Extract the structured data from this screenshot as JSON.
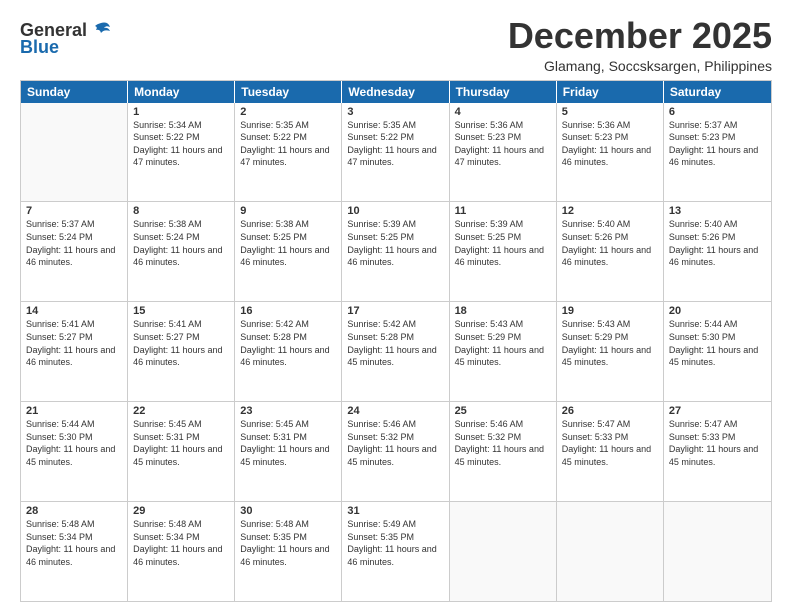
{
  "logo": {
    "line1": "General",
    "line2": "Blue"
  },
  "title": "December 2025",
  "subtitle": "Glamang, Soccsksargen, Philippines",
  "days_of_week": [
    "Sunday",
    "Monday",
    "Tuesday",
    "Wednesday",
    "Thursday",
    "Friday",
    "Saturday"
  ],
  "weeks": [
    [
      {
        "day": "",
        "sunrise": "",
        "sunset": "",
        "daylight": ""
      },
      {
        "day": "1",
        "sunrise": "Sunrise: 5:34 AM",
        "sunset": "Sunset: 5:22 PM",
        "daylight": "Daylight: 11 hours and 47 minutes."
      },
      {
        "day": "2",
        "sunrise": "Sunrise: 5:35 AM",
        "sunset": "Sunset: 5:22 PM",
        "daylight": "Daylight: 11 hours and 47 minutes."
      },
      {
        "day": "3",
        "sunrise": "Sunrise: 5:35 AM",
        "sunset": "Sunset: 5:22 PM",
        "daylight": "Daylight: 11 hours and 47 minutes."
      },
      {
        "day": "4",
        "sunrise": "Sunrise: 5:36 AM",
        "sunset": "Sunset: 5:23 PM",
        "daylight": "Daylight: 11 hours and 47 minutes."
      },
      {
        "day": "5",
        "sunrise": "Sunrise: 5:36 AM",
        "sunset": "Sunset: 5:23 PM",
        "daylight": "Daylight: 11 hours and 46 minutes."
      },
      {
        "day": "6",
        "sunrise": "Sunrise: 5:37 AM",
        "sunset": "Sunset: 5:23 PM",
        "daylight": "Daylight: 11 hours and 46 minutes."
      }
    ],
    [
      {
        "day": "7",
        "sunrise": "Sunrise: 5:37 AM",
        "sunset": "Sunset: 5:24 PM",
        "daylight": "Daylight: 11 hours and 46 minutes."
      },
      {
        "day": "8",
        "sunrise": "Sunrise: 5:38 AM",
        "sunset": "Sunset: 5:24 PM",
        "daylight": "Daylight: 11 hours and 46 minutes."
      },
      {
        "day": "9",
        "sunrise": "Sunrise: 5:38 AM",
        "sunset": "Sunset: 5:25 PM",
        "daylight": "Daylight: 11 hours and 46 minutes."
      },
      {
        "day": "10",
        "sunrise": "Sunrise: 5:39 AM",
        "sunset": "Sunset: 5:25 PM",
        "daylight": "Daylight: 11 hours and 46 minutes."
      },
      {
        "day": "11",
        "sunrise": "Sunrise: 5:39 AM",
        "sunset": "Sunset: 5:25 PM",
        "daylight": "Daylight: 11 hours and 46 minutes."
      },
      {
        "day": "12",
        "sunrise": "Sunrise: 5:40 AM",
        "sunset": "Sunset: 5:26 PM",
        "daylight": "Daylight: 11 hours and 46 minutes."
      },
      {
        "day": "13",
        "sunrise": "Sunrise: 5:40 AM",
        "sunset": "Sunset: 5:26 PM",
        "daylight": "Daylight: 11 hours and 46 minutes."
      }
    ],
    [
      {
        "day": "14",
        "sunrise": "Sunrise: 5:41 AM",
        "sunset": "Sunset: 5:27 PM",
        "daylight": "Daylight: 11 hours and 46 minutes."
      },
      {
        "day": "15",
        "sunrise": "Sunrise: 5:41 AM",
        "sunset": "Sunset: 5:27 PM",
        "daylight": "Daylight: 11 hours and 46 minutes."
      },
      {
        "day": "16",
        "sunrise": "Sunrise: 5:42 AM",
        "sunset": "Sunset: 5:28 PM",
        "daylight": "Daylight: 11 hours and 46 minutes."
      },
      {
        "day": "17",
        "sunrise": "Sunrise: 5:42 AM",
        "sunset": "Sunset: 5:28 PM",
        "daylight": "Daylight: 11 hours and 45 minutes."
      },
      {
        "day": "18",
        "sunrise": "Sunrise: 5:43 AM",
        "sunset": "Sunset: 5:29 PM",
        "daylight": "Daylight: 11 hours and 45 minutes."
      },
      {
        "day": "19",
        "sunrise": "Sunrise: 5:43 AM",
        "sunset": "Sunset: 5:29 PM",
        "daylight": "Daylight: 11 hours and 45 minutes."
      },
      {
        "day": "20",
        "sunrise": "Sunrise: 5:44 AM",
        "sunset": "Sunset: 5:30 PM",
        "daylight": "Daylight: 11 hours and 45 minutes."
      }
    ],
    [
      {
        "day": "21",
        "sunrise": "Sunrise: 5:44 AM",
        "sunset": "Sunset: 5:30 PM",
        "daylight": "Daylight: 11 hours and 45 minutes."
      },
      {
        "day": "22",
        "sunrise": "Sunrise: 5:45 AM",
        "sunset": "Sunset: 5:31 PM",
        "daylight": "Daylight: 11 hours and 45 minutes."
      },
      {
        "day": "23",
        "sunrise": "Sunrise: 5:45 AM",
        "sunset": "Sunset: 5:31 PM",
        "daylight": "Daylight: 11 hours and 45 minutes."
      },
      {
        "day": "24",
        "sunrise": "Sunrise: 5:46 AM",
        "sunset": "Sunset: 5:32 PM",
        "daylight": "Daylight: 11 hours and 45 minutes."
      },
      {
        "day": "25",
        "sunrise": "Sunrise: 5:46 AM",
        "sunset": "Sunset: 5:32 PM",
        "daylight": "Daylight: 11 hours and 45 minutes."
      },
      {
        "day": "26",
        "sunrise": "Sunrise: 5:47 AM",
        "sunset": "Sunset: 5:33 PM",
        "daylight": "Daylight: 11 hours and 45 minutes."
      },
      {
        "day": "27",
        "sunrise": "Sunrise: 5:47 AM",
        "sunset": "Sunset: 5:33 PM",
        "daylight": "Daylight: 11 hours and 45 minutes."
      }
    ],
    [
      {
        "day": "28",
        "sunrise": "Sunrise: 5:48 AM",
        "sunset": "Sunset: 5:34 PM",
        "daylight": "Daylight: 11 hours and 46 minutes."
      },
      {
        "day": "29",
        "sunrise": "Sunrise: 5:48 AM",
        "sunset": "Sunset: 5:34 PM",
        "daylight": "Daylight: 11 hours and 46 minutes."
      },
      {
        "day": "30",
        "sunrise": "Sunrise: 5:48 AM",
        "sunset": "Sunset: 5:35 PM",
        "daylight": "Daylight: 11 hours and 46 minutes."
      },
      {
        "day": "31",
        "sunrise": "Sunrise: 5:49 AM",
        "sunset": "Sunset: 5:35 PM",
        "daylight": "Daylight: 11 hours and 46 minutes."
      },
      {
        "day": "",
        "sunrise": "",
        "sunset": "",
        "daylight": ""
      },
      {
        "day": "",
        "sunrise": "",
        "sunset": "",
        "daylight": ""
      },
      {
        "day": "",
        "sunrise": "",
        "sunset": "",
        "daylight": ""
      }
    ]
  ]
}
